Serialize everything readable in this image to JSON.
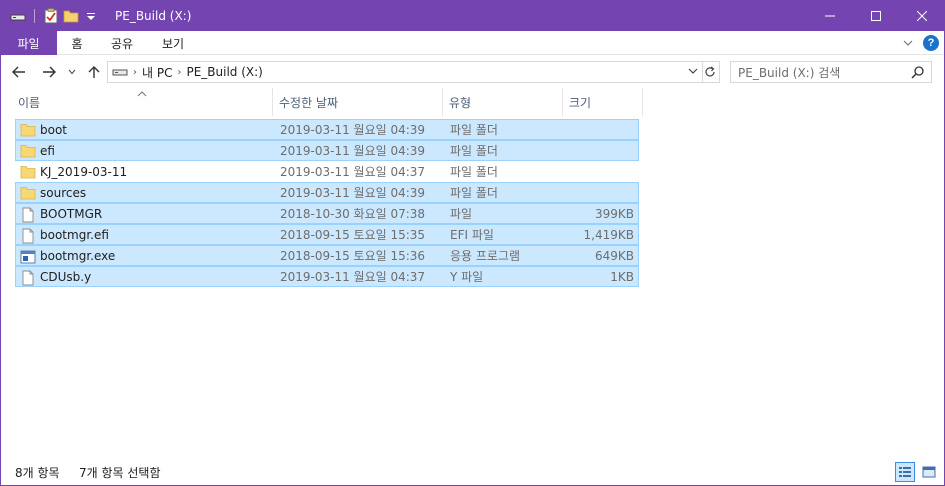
{
  "window": {
    "title": "PE_Build (X:)",
    "accent": "#7444b0"
  },
  "ribbon": {
    "tabs": [
      {
        "label": "파일"
      },
      {
        "label": "홈"
      },
      {
        "label": "공유"
      },
      {
        "label": "보기"
      }
    ]
  },
  "address": {
    "crumbs": [
      "내 PC",
      "PE_Build (X:)"
    ]
  },
  "search": {
    "placeholder": "PE_Build (X:) 검색"
  },
  "columns": {
    "name": "이름",
    "date": "수정한 날짜",
    "type": "유형",
    "size": "크기"
  },
  "files": [
    {
      "name": "boot",
      "date": "2019-03-11 월요일 04:39",
      "type": "파일 폴더",
      "size": "",
      "icon": "folder-icon",
      "selected": true
    },
    {
      "name": "efi",
      "date": "2019-03-11 월요일 04:39",
      "type": "파일 폴더",
      "size": "",
      "icon": "folder-icon",
      "selected": true
    },
    {
      "name": "KJ_2019-03-11",
      "date": "2019-03-11 월요일 04:37",
      "type": "파일 폴더",
      "size": "",
      "icon": "folder-icon",
      "selected": false
    },
    {
      "name": "sources",
      "date": "2019-03-11 월요일 04:39",
      "type": "파일 폴더",
      "size": "",
      "icon": "folder-icon",
      "selected": true
    },
    {
      "name": "BOOTMGR",
      "date": "2018-10-30 화요일 07:38",
      "type": "파일",
      "size": "399KB",
      "icon": "file-icon",
      "selected": true
    },
    {
      "name": "bootmgr.efi",
      "date": "2018-09-15 토요일 15:35",
      "type": "EFI 파일",
      "size": "1,419KB",
      "icon": "file-icon",
      "selected": true
    },
    {
      "name": "bootmgr.exe",
      "date": "2018-09-15 토요일 15:36",
      "type": "응용 프로그램",
      "size": "649KB",
      "icon": "exe-icon",
      "selected": true
    },
    {
      "name": "CDUsb.y",
      "date": "2019-03-11 월요일 04:37",
      "type": "Y 파일",
      "size": "1KB",
      "icon": "file-icon",
      "selected": true
    }
  ],
  "status": {
    "count": "8개 항목",
    "selected": "7개 항목 선택함"
  }
}
